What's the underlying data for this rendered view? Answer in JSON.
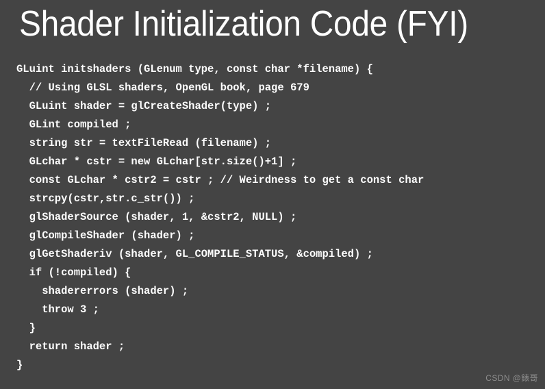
{
  "slide": {
    "title": "Shader Initialization Code (FYI)",
    "background_color": "#444444",
    "title_color": "#ffffff",
    "code_color": "#fdfdfd",
    "watermark_color": "#8d8d8d"
  },
  "code": {
    "language": "cpp",
    "lines": [
      "GLuint initshaders (GLenum type, const char *filename) {",
      "  // Using GLSL shaders, OpenGL book, page 679",
      "  GLuint shader = glCreateShader(type) ;",
      "  GLint compiled ;",
      "  string str = textFileRead (filename) ;",
      "  GLchar * cstr = new GLchar[str.size()+1] ;",
      "  const GLchar * cstr2 = cstr ; // Weirdness to get a const char",
      "  strcpy(cstr,str.c_str()) ;",
      "  glShaderSource (shader, 1, &cstr2, NULL) ;",
      "  glCompileShader (shader) ;",
      "  glGetShaderiv (shader, GL_COMPILE_STATUS, &compiled) ;",
      "  if (!compiled) {",
      "    shadererrors (shader) ;",
      "    throw 3 ;",
      "  }",
      "  return shader ;",
      "}"
    ]
  },
  "watermark": {
    "text": "CSDN @錶哥"
  }
}
